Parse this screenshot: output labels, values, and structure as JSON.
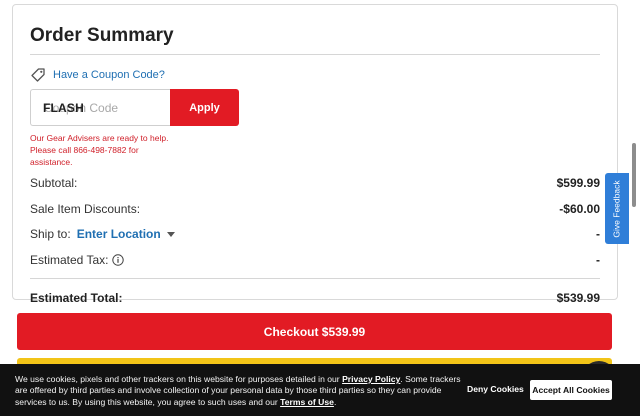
{
  "order_summary": {
    "title": "Order Summary",
    "coupon_toggle_label": "Have a Coupon Code?",
    "coupon_placeholder": "Coupon Code",
    "coupon_value": "FLASH",
    "apply_label": "Apply",
    "error_message": "Our Gear Advisers are ready to help. Please call 866-498-7882 for assistance.",
    "subtotal": {
      "label": "Subtotal:",
      "value": "$599.99"
    },
    "discounts": {
      "label": "Sale Item Discounts:",
      "value": "-$60.00"
    },
    "ship_to": {
      "label": "Ship to:",
      "link": "Enter Location",
      "value": "-"
    },
    "tax": {
      "label": "Estimated Tax:",
      "value": "-"
    },
    "total": {
      "label": "Estimated Total:",
      "value": "$539.99"
    }
  },
  "checkout": {
    "label": "Checkout $539.99"
  },
  "feedback": {
    "label": "Give Feedback"
  },
  "cookie_banner": {
    "text_1": "We use cookies, pixels and other trackers on this website for purposes detailed in our ",
    "privacy_link": "Privacy Policy",
    "text_2": ". Some trackers are offered by third parties and involve collection of your personal data by those third parties so they can provide services to us. By using this website, you agree to such uses and our ",
    "terms_link": "Terms of Use",
    "text_3": ".",
    "deny_label": "Deny Cookies",
    "accept_label": "Accept All Cookies"
  },
  "colors": {
    "brand_red": "#e21b24",
    "link_blue": "#1f6fb2",
    "feedback_blue": "#2f7ed8",
    "paypal_yellow": "#f2c418"
  },
  "icons": [
    "tag-icon",
    "caret-down-icon",
    "info-icon"
  ]
}
